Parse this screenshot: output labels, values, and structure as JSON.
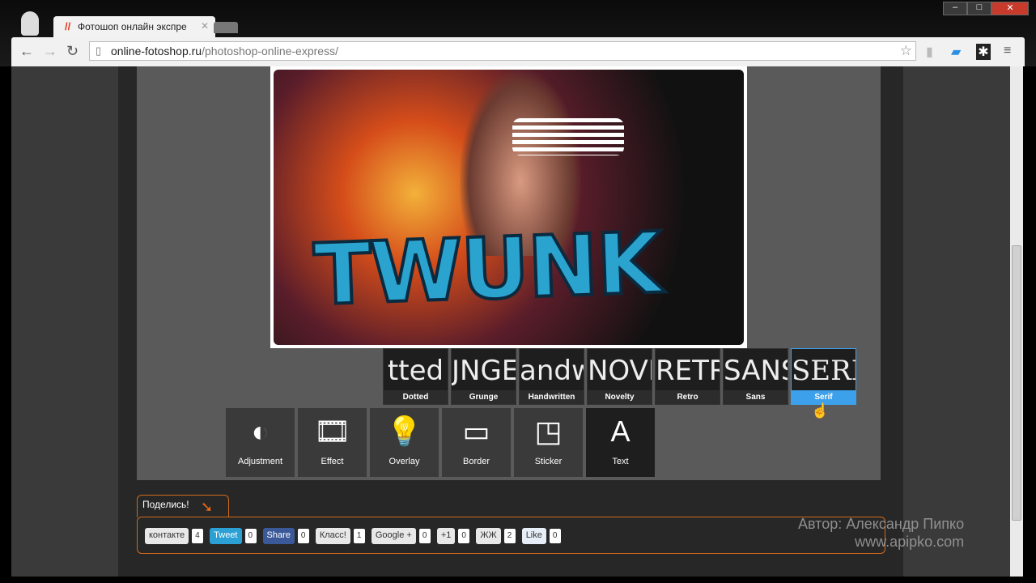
{
  "browser": {
    "tab_title": "Фотошоп онлайн экспре",
    "url_host": "online-fotoshop.ru",
    "url_path": "/photoshop-online-express/"
  },
  "photo": {
    "overlay_text": "TWUNK"
  },
  "fonts": [
    {
      "label": "Dotted",
      "preview": "tted"
    },
    {
      "label": "Grunge",
      "preview": "JNGE"
    },
    {
      "label": "Handwritten",
      "preview": "andwrit"
    },
    {
      "label": "Novelty",
      "preview": "NOVEL"
    },
    {
      "label": "Retro",
      "preview": "RETRO"
    },
    {
      "label": "Sans",
      "preview": "SANS"
    },
    {
      "label": "Serif",
      "preview": "SERIF",
      "selected": true
    }
  ],
  "tools": [
    {
      "label": "Adjustment",
      "icon": "adjustment-icon",
      "glyph": "◐"
    },
    {
      "label": "Effect",
      "icon": "film-icon",
      "glyph": "🎞"
    },
    {
      "label": "Overlay",
      "icon": "lightbulb-icon",
      "glyph": "💡"
    },
    {
      "label": "Border",
      "icon": "border-icon",
      "glyph": "▭"
    },
    {
      "label": "Sticker",
      "icon": "sticker-icon",
      "glyph": "◳"
    },
    {
      "label": "Text",
      "icon": "text-icon",
      "glyph": "A",
      "selected": true
    }
  ],
  "share": {
    "title": "Поделись!",
    "buttons": [
      {
        "label": "контакте",
        "count": "4",
        "color": "#e8e8e8"
      },
      {
        "label": "Tweet",
        "count": "0",
        "color": "#2aa0d4"
      },
      {
        "label": "Share",
        "count": "0",
        "color": "#3b5998"
      },
      {
        "label": "Класс!",
        "count": "1",
        "color": "#e8e8e8"
      },
      {
        "label": "Google +",
        "count": "0",
        "color": "#e8e8e8"
      },
      {
        "label": "+1",
        "count": "0",
        "color": "#e8e8e8"
      },
      {
        "label": "ЖЖ",
        "count": "2",
        "color": "#e8e8e8"
      },
      {
        "label": "Like",
        "count": "0",
        "color": "#e8eef8"
      }
    ]
  },
  "author": {
    "line1": "Автор: Александр Пипко",
    "line2": "www.apipko.com"
  },
  "colors": {
    "accent": "#3ca0ea",
    "share_border": "#d06a1c"
  }
}
